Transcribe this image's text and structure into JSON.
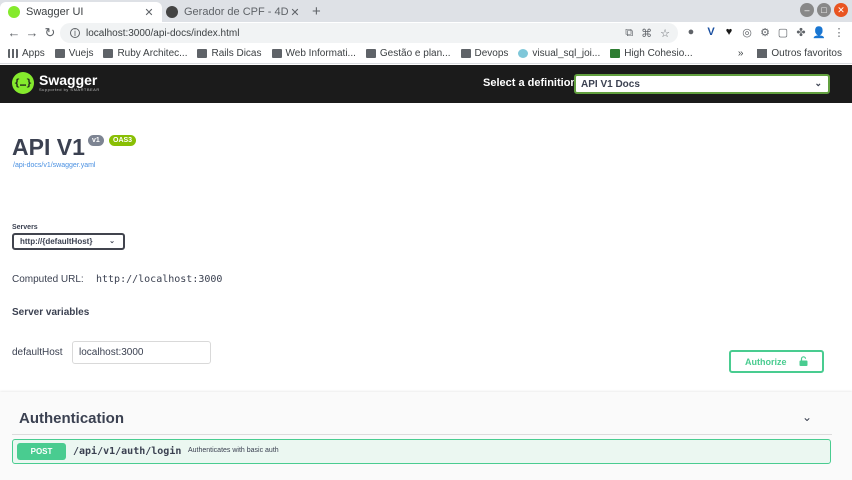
{
  "browser": {
    "tabs": [
      {
        "title": "Swagger UI",
        "favicon_color": "#85ea2d"
      },
      {
        "title": "Gerador de CPF - 4Devs",
        "favicon_color": "#444444"
      }
    ],
    "url": "localhost:3000/api-docs/index.html",
    "bookmarks": [
      {
        "label": "Apps",
        "icon": "apps-grid-icon"
      },
      {
        "label": "Vuejs",
        "icon": "folder-icon"
      },
      {
        "label": "Ruby Architec...",
        "icon": "folder-icon"
      },
      {
        "label": "Rails Dicas",
        "icon": "folder-icon"
      },
      {
        "label": "Web Informati...",
        "icon": "folder-icon"
      },
      {
        "label": "Gestão e plan...",
        "icon": "folder-icon"
      },
      {
        "label": "Devops",
        "icon": "folder-icon"
      },
      {
        "label": "visual_sql_joi...",
        "icon": "globe-icon"
      },
      {
        "label": "High Cohesio...",
        "icon": "page-icon"
      }
    ],
    "bookmarks_overflow": "»",
    "other_bookmarks": "Outros favoritos"
  },
  "topbar": {
    "logo_name": "Swagger",
    "logo_sub": "Supported by SMARTBEAR",
    "definition_label": "Select a definition",
    "definition_value": "API V1 Docs"
  },
  "info": {
    "title": "API V1",
    "version_badge": "v1",
    "oas_badge": "OAS3",
    "spec_link": "/api-docs/v1/swagger.yaml"
  },
  "servers": {
    "label": "Servers",
    "selected": "http://{defaultHost}",
    "computed_label": "Computed URL:",
    "computed_url": "http://localhost:3000",
    "variables_title": "Server variables",
    "variable_name": "defaultHost",
    "variable_value": "localhost:3000"
  },
  "authorize_label": "Authorize",
  "operations": {
    "tag": "Authentication",
    "items": [
      {
        "method": "POST",
        "path": "/api/v1/auth/login",
        "summary": "Authenticates with basic auth"
      }
    ]
  },
  "colors": {
    "swagger_green": "#85ea2d",
    "post_green": "#49cc90",
    "topbar_bg": "#1b1b1b",
    "text": "#3b4151"
  }
}
